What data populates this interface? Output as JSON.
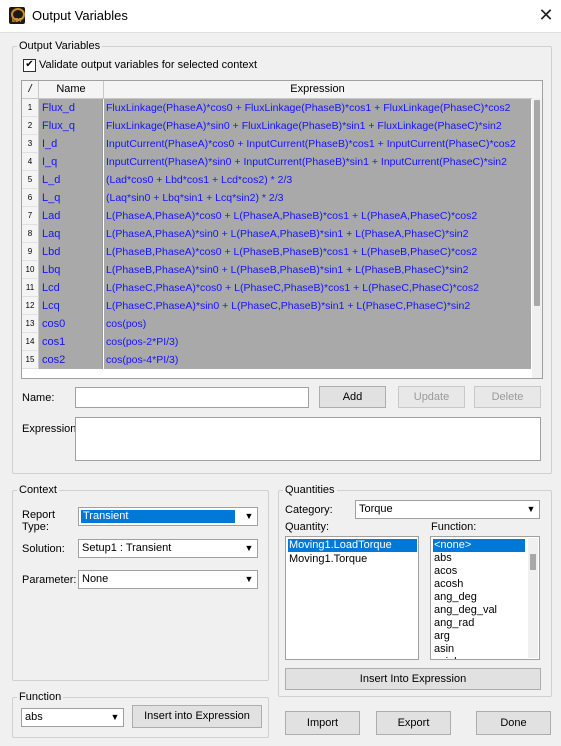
{
  "window": {
    "title": "Output Variables",
    "icon_text": "EDT",
    "close_glyph": "✕"
  },
  "output_variables": {
    "legend": "Output Variables",
    "validate_checkbox": {
      "label": "Validate output variables for selected context",
      "checked": true,
      "glyph": "✔"
    },
    "grid": {
      "columns": {
        "sort_indicator": "/",
        "name": "Name",
        "expression": "Expression"
      },
      "rows": [
        {
          "num": "1",
          "name": "Flux_d",
          "expr": "FluxLinkage(PhaseA)*cos0 + FluxLinkage(PhaseB)*cos1 + FluxLinkage(PhaseC)*cos2"
        },
        {
          "num": "2",
          "name": "Flux_q",
          "expr": "FluxLinkage(PhaseA)*sin0 + FluxLinkage(PhaseB)*sin1 + FluxLinkage(PhaseC)*sin2"
        },
        {
          "num": "3",
          "name": "I_d",
          "expr": "InputCurrent(PhaseA)*cos0 + InputCurrent(PhaseB)*cos1 + InputCurrent(PhaseC)*cos2"
        },
        {
          "num": "4",
          "name": "I_q",
          "expr": "InputCurrent(PhaseA)*sin0 + InputCurrent(PhaseB)*sin1 + InputCurrent(PhaseC)*sin2"
        },
        {
          "num": "5",
          "name": "L_d",
          "expr": "(Lad*cos0 + Lbd*cos1 + Lcd*cos2) * 2/3"
        },
        {
          "num": "6",
          "name": "L_q",
          "expr": "(Laq*sin0 + Lbq*sin1 + Lcq*sin2) * 2/3"
        },
        {
          "num": "7",
          "name": "Lad",
          "expr": "L(PhaseA,PhaseA)*cos0 + L(PhaseA,PhaseB)*cos1 + L(PhaseA,PhaseC)*cos2"
        },
        {
          "num": "8",
          "name": "Laq",
          "expr": "L(PhaseA,PhaseA)*sin0 + L(PhaseA,PhaseB)*sin1 + L(PhaseA,PhaseC)*sin2"
        },
        {
          "num": "9",
          "name": "Lbd",
          "expr": "L(PhaseB,PhaseA)*cos0 + L(PhaseB,PhaseB)*cos1 + L(PhaseB,PhaseC)*cos2"
        },
        {
          "num": "10",
          "name": "Lbq",
          "expr": "L(PhaseB,PhaseA)*sin0 + L(PhaseB,PhaseB)*sin1 + L(PhaseB,PhaseC)*sin2"
        },
        {
          "num": "11",
          "name": "Lcd",
          "expr": "L(PhaseC,PhaseA)*cos0 + L(PhaseC,PhaseB)*cos1 + L(PhaseC,PhaseC)*cos2"
        },
        {
          "num": "12",
          "name": "Lcq",
          "expr": "L(PhaseC,PhaseA)*sin0 + L(PhaseC,PhaseB)*sin1 + L(PhaseC,PhaseC)*sin2"
        },
        {
          "num": "13",
          "name": "cos0",
          "expr": "cos(pos)"
        },
        {
          "num": "14",
          "name": "cos1",
          "expr": "cos(pos-2*PI/3)"
        },
        {
          "num": "15",
          "name": "cos2",
          "expr": "cos(pos-4*PI/3)"
        }
      ]
    },
    "name_label": "Name:",
    "name_value": "",
    "add_button": "Add",
    "update_button": "Update",
    "delete_button": "Delete",
    "expression_label": "Expression:",
    "expression_value": ""
  },
  "context": {
    "legend": "Context",
    "report_type_label_1": "Report",
    "report_type_label_2": "Type:",
    "report_type_value": "Transient",
    "solution_label": "Solution:",
    "solution_value": "Setup1 : Transient",
    "parameter_label": "Parameter:",
    "parameter_value": "None"
  },
  "quantities": {
    "legend": "Quantities",
    "category_label": "Category:",
    "category_value": "Torque",
    "quantity_label": "Quantity:",
    "quantity_items": [
      "Moving1.LoadTorque",
      "Moving1.Torque"
    ],
    "quantity_selected": 0,
    "function_label": "Function:",
    "function_items": [
      "<none>",
      "abs",
      "acos",
      "acosh",
      "ang_deg",
      "ang_deg_val",
      "ang_rad",
      "arg",
      "asin",
      "asinh"
    ],
    "function_selected": 0,
    "insert_button": "Insert Into Expression"
  },
  "function_group": {
    "legend": "Function",
    "function_value": "abs",
    "insert_button": "Insert into Expression"
  },
  "footer": {
    "import_button": "Import",
    "export_button": "Export",
    "done_button": "Done"
  },
  "colors": {
    "grid_cell_bg": "#a9a9a9",
    "grid_text": "#1414ff",
    "selection": "#0078d7"
  },
  "icons": {
    "dropdown_arrow": "▼"
  }
}
